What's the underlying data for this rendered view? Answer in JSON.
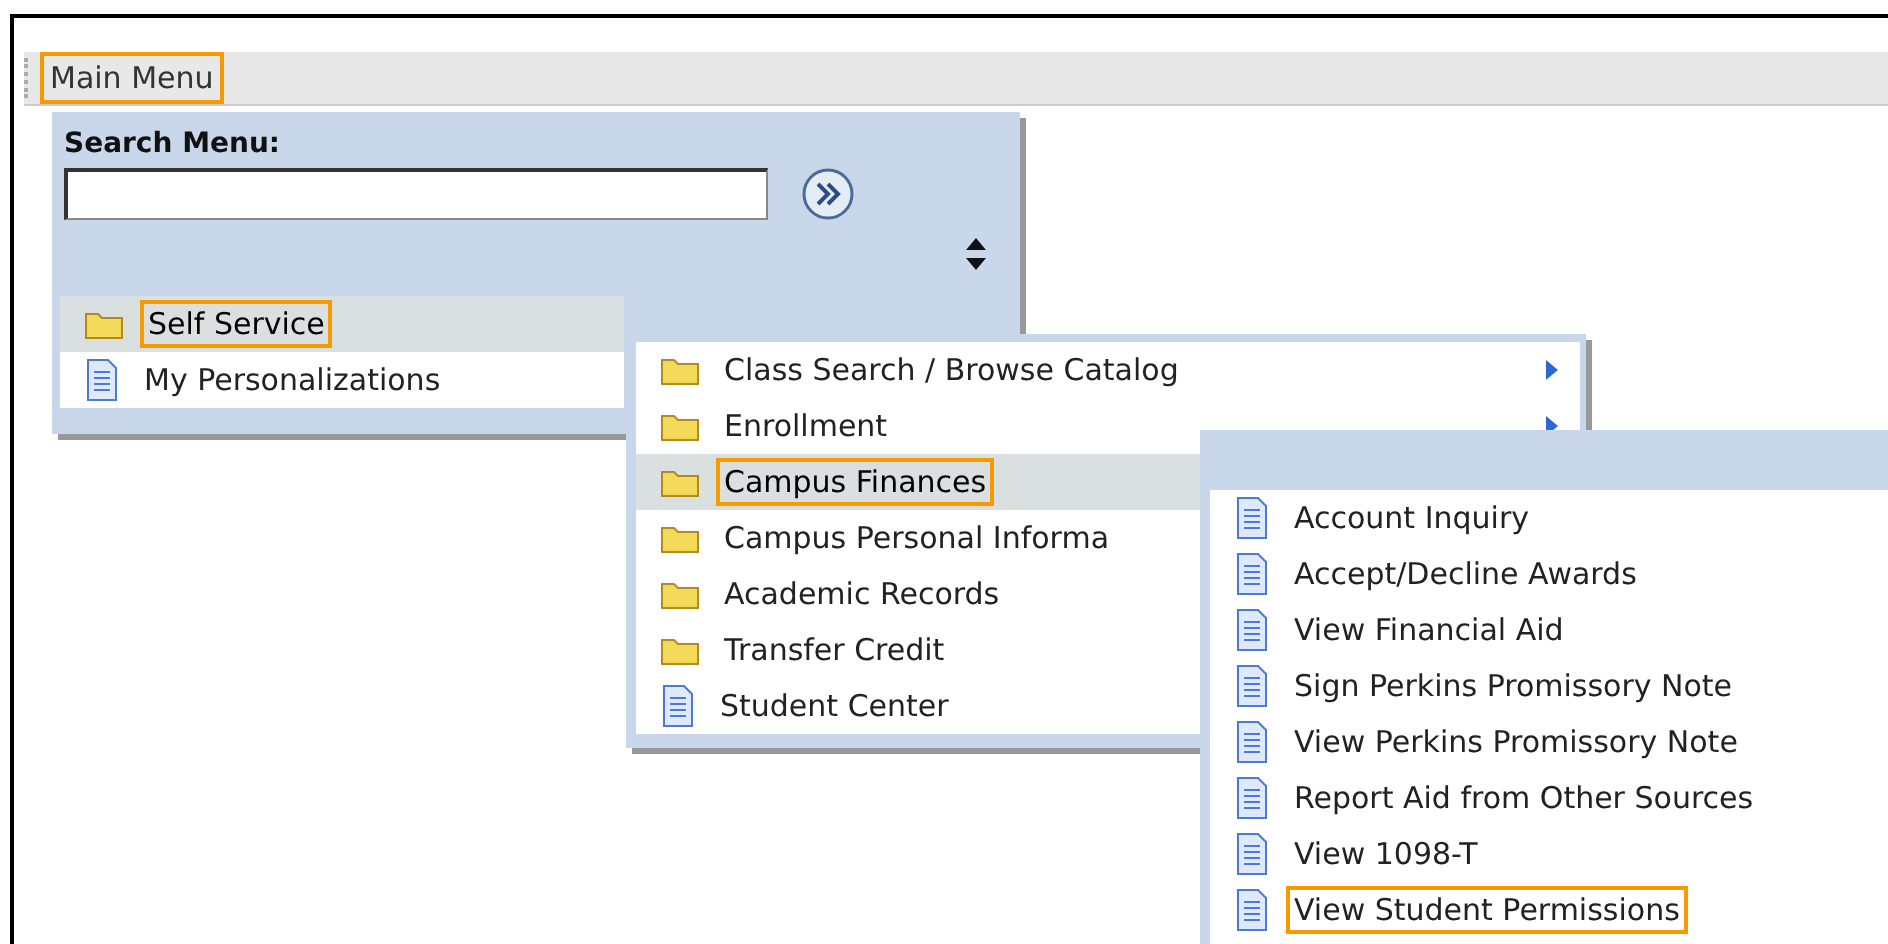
{
  "menu_bar": {
    "label": "Main Menu",
    "highlighted": true
  },
  "search": {
    "label": "Search Menu:"
  },
  "menus": [
    {
      "items": [
        {
          "label": "Self Service",
          "kind": "folder",
          "selected": true,
          "highlighted": true
        },
        {
          "label": "My Personalizations",
          "kind": "page",
          "selected": false,
          "highlighted": false
        }
      ]
    },
    {
      "items": [
        {
          "label": "Class Search / Browse Catalog",
          "kind": "folder",
          "selected": false,
          "highlighted": false,
          "has_submenu": true
        },
        {
          "label": "Enrollment",
          "kind": "folder",
          "selected": false,
          "highlighted": false,
          "has_submenu": true
        },
        {
          "label": "Campus Finances",
          "kind": "folder",
          "selected": true,
          "highlighted": true
        },
        {
          "label": "Campus Personal Informa",
          "kind": "folder",
          "selected": false,
          "highlighted": false
        },
        {
          "label": "Academic Records",
          "kind": "folder",
          "selected": false,
          "highlighted": false
        },
        {
          "label": "Transfer Credit",
          "kind": "folder",
          "selected": false,
          "highlighted": false
        },
        {
          "label": "Student Center",
          "kind": "page",
          "selected": false,
          "highlighted": false
        }
      ]
    },
    {
      "items": [
        {
          "label": "Account Inquiry",
          "kind": "page",
          "selected": false,
          "highlighted": false
        },
        {
          "label": "Accept/Decline Awards",
          "kind": "page",
          "selected": false,
          "highlighted": false
        },
        {
          "label": "View Financial Aid",
          "kind": "page",
          "selected": false,
          "highlighted": false
        },
        {
          "label": "Sign Perkins Promissory Note",
          "kind": "page",
          "selected": false,
          "highlighted": false
        },
        {
          "label": "View Perkins Promissory Note",
          "kind": "page",
          "selected": false,
          "highlighted": false
        },
        {
          "label": "Report Aid from Other Sources",
          "kind": "page",
          "selected": false,
          "highlighted": false
        },
        {
          "label": "View 1098-T",
          "kind": "page",
          "selected": false,
          "highlighted": false
        },
        {
          "label": "View Student Permissions",
          "kind": "page",
          "selected": false,
          "highlighted": true
        }
      ]
    }
  ]
}
